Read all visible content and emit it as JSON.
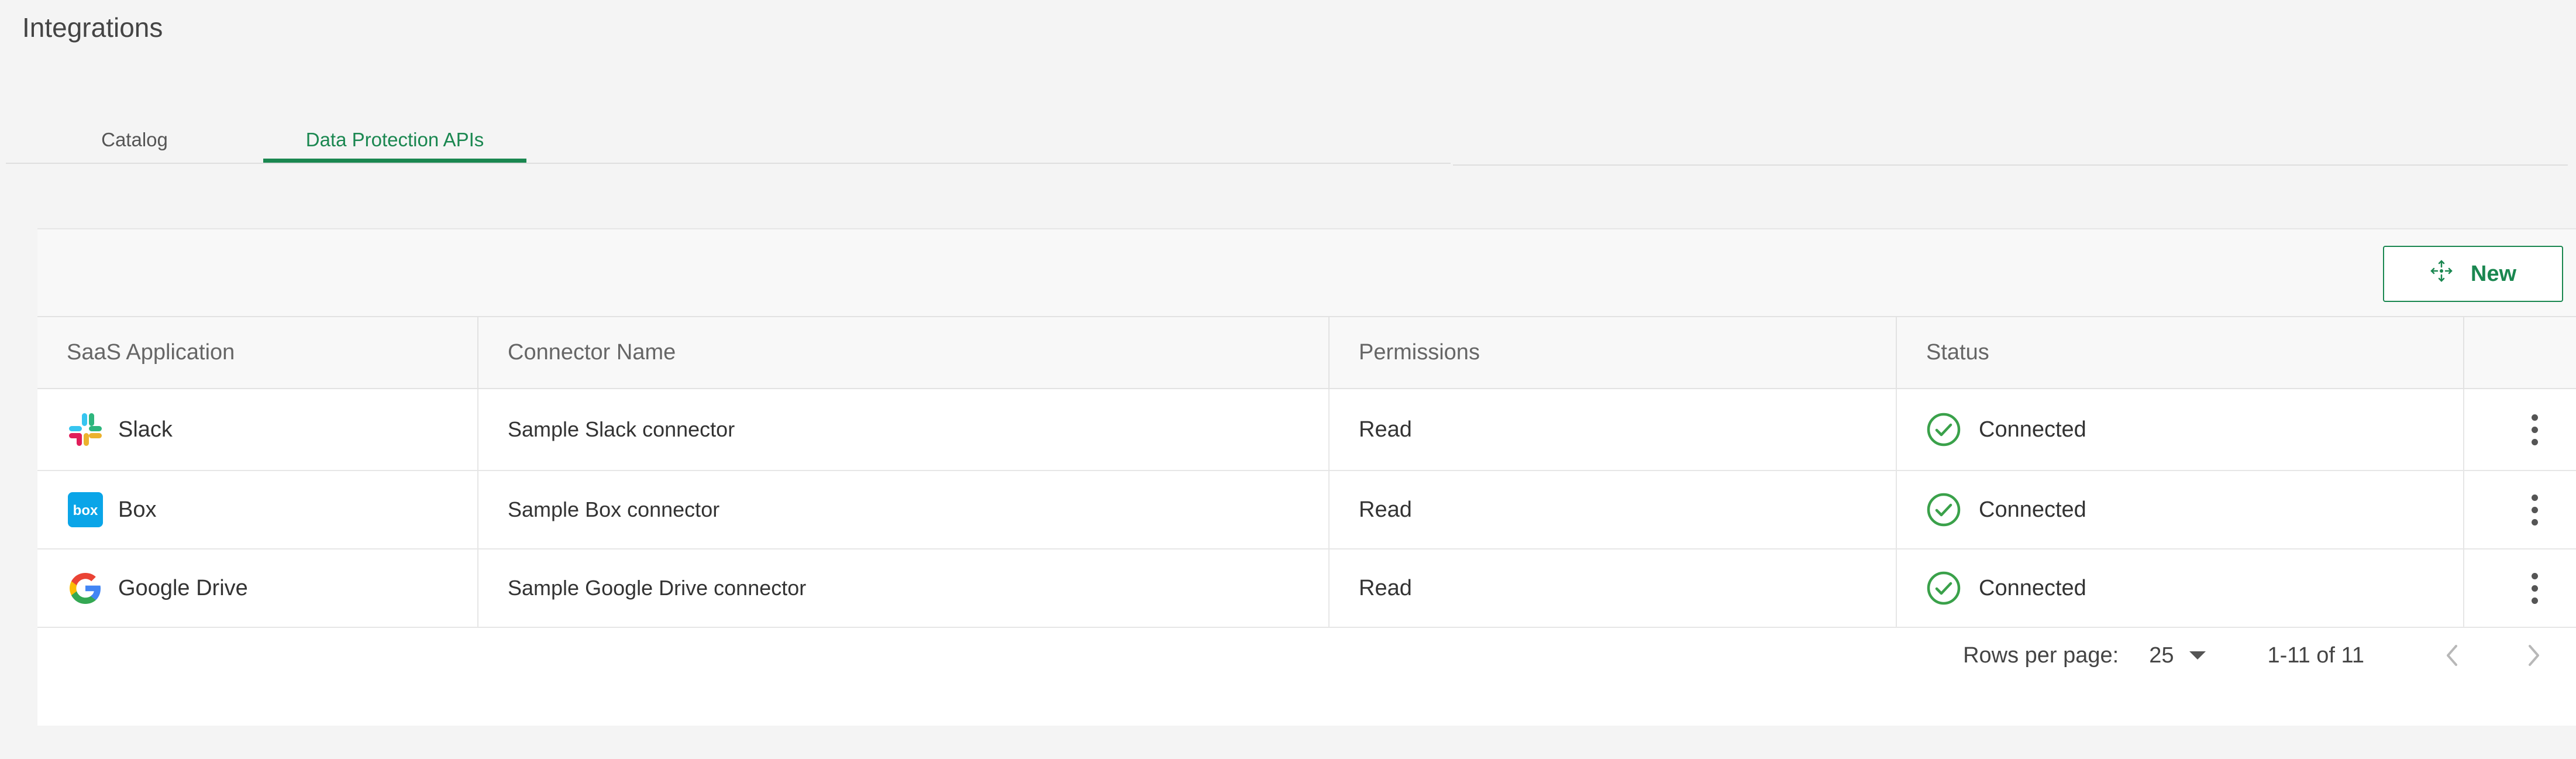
{
  "header": {
    "title": "Integrations"
  },
  "tabs": [
    {
      "label": "Catalog",
      "active": false
    },
    {
      "label": "Data Protection APIs",
      "active": true
    }
  ],
  "toolbar": {
    "new_label": "New",
    "icon": "move-icon"
  },
  "table": {
    "columns": [
      "SaaS Application",
      "Connector Name",
      "Permissions",
      "Status"
    ],
    "rows": [
      {
        "app": "Slack",
        "icon": "slack-logo-icon",
        "connector": "Sample Slack connector",
        "permissions": "Read",
        "status": "Connected"
      },
      {
        "app": "Box",
        "icon": "box-logo-icon",
        "connector": "Sample Box connector",
        "permissions": "Read",
        "status": "Connected"
      },
      {
        "app": "Google Drive",
        "icon": "google-logo-icon",
        "connector": "Sample Google Drive connector",
        "permissions": "Read",
        "status": "Connected"
      }
    ]
  },
  "pagination": {
    "rows_per_page_label": "Rows per page:",
    "rows_per_page_value": "25",
    "range": "1-11 of 11"
  },
  "colors": {
    "accent": "#1a8750",
    "status_ok": "#3aa14a",
    "box_brand": "#0aa5e8"
  }
}
